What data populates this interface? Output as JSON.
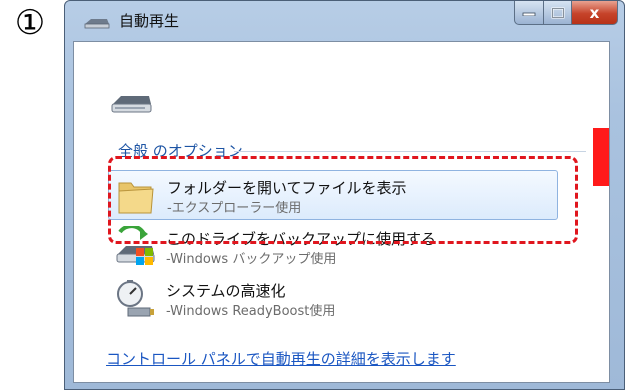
{
  "step_badge": "①",
  "window": {
    "title": "自動再生",
    "caption": {
      "minimize_icon": "minimize-icon",
      "maximize_icon": "maximize-icon",
      "close_label": "x"
    }
  },
  "content": {
    "drive_icon": "removable-drive-icon",
    "section_header": "全般 のオプション",
    "options": [
      {
        "title": "フォルダーを開いてファイルを表示",
        "subtitle": "-エクスプローラー使用",
        "icon": "folder-icon",
        "highlighted": true
      },
      {
        "title": "このドライブをバックアップに使用する",
        "subtitle": "-Windows バックアップ使用",
        "icon": "backup-drive-icon",
        "highlighted": false
      },
      {
        "title": "システムの高速化",
        "subtitle": "-Windows ReadyBoost使用",
        "icon": "readyboost-icon",
        "highlighted": false
      }
    ],
    "footer_link": "コントロール パネルで自動再生の詳細を表示します"
  },
  "colors": {
    "annotation_red": "#e0161e",
    "link_blue": "#1a56c2",
    "header_blue": "#1d54a4"
  }
}
